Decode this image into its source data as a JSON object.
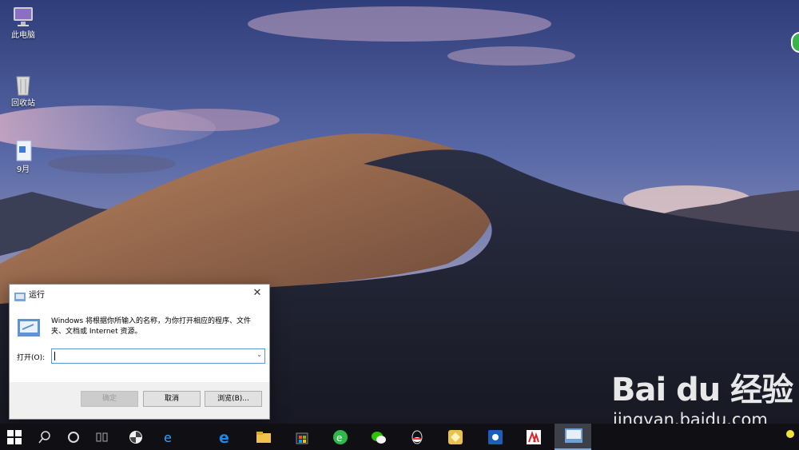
{
  "desktop": {
    "icons": [
      {
        "label": "此电脑",
        "icon": "computer-icon"
      },
      {
        "label": "回收站",
        "icon": "recycle-bin-icon"
      },
      {
        "label": "9月",
        "icon": "document-icon"
      }
    ]
  },
  "run_dialog": {
    "title": "运行",
    "description": "Windows 将根据你所输入的名称，为你打开相应的程序、文件夹、文档或 Internet 资源。",
    "open_label": "打开(O):",
    "input_value": "",
    "ok_label": "确定",
    "cancel_label": "取消",
    "browse_label": "浏览(B)...",
    "close_glyph": "✕"
  },
  "taskbar": {
    "items": [
      "start-icon",
      "search-icon",
      "cortana-icon",
      "task-view-icon",
      "pinwheel-icon",
      "ie-icon",
      "edge-icon",
      "file-explorer-icon",
      "store-icon",
      "browser-360-icon",
      "wechat-icon",
      "qq-icon",
      "app-gold-icon",
      "app-blue-icon",
      "app-red-icon",
      "run-app-icon"
    ]
  },
  "watermark": {
    "logo": "Bai du 经验",
    "url": "jingyan.baidu.com"
  },
  "colors": {
    "taskbar": "#101014",
    "dialog_border": "#5b97d6",
    "tray_badge": "#3bb54a"
  }
}
